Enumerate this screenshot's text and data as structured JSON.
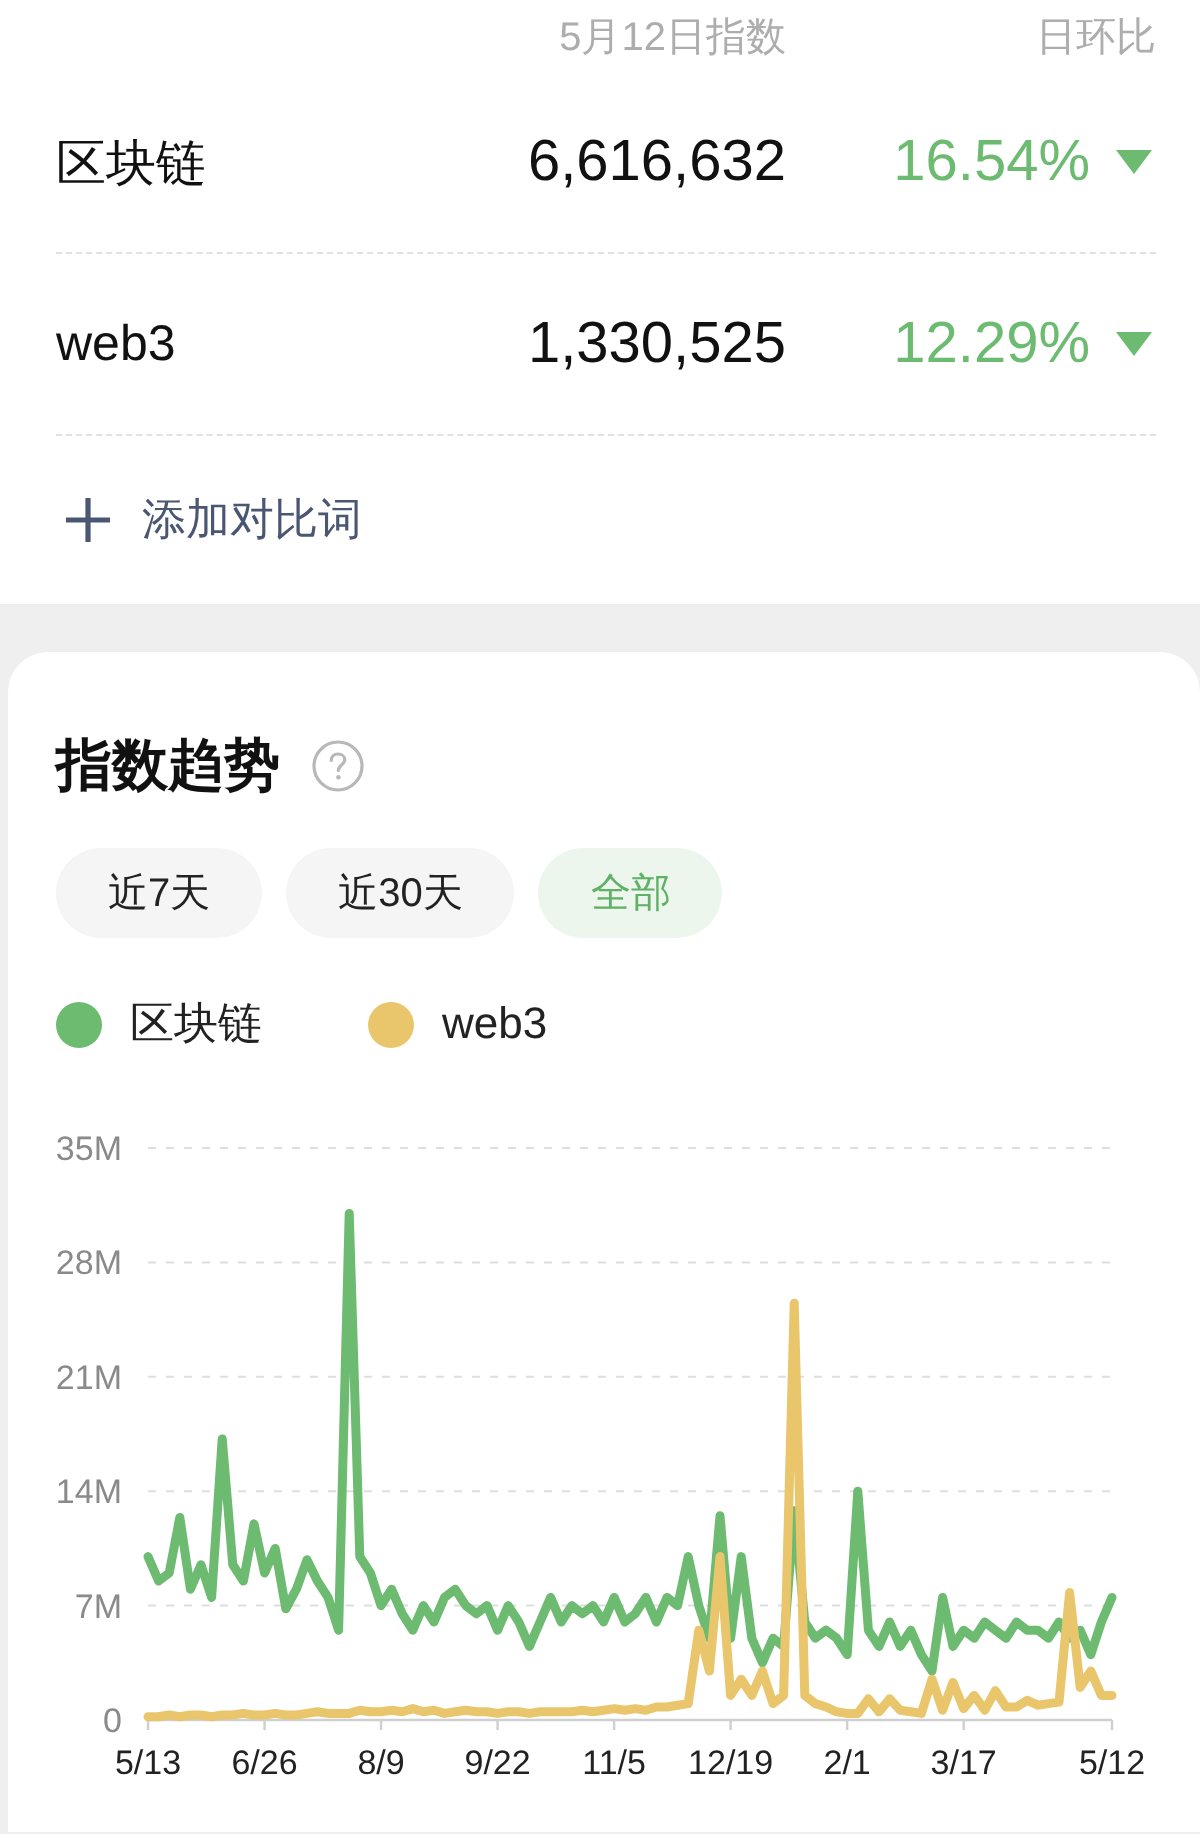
{
  "header": {
    "index_label": "5月12日指数",
    "change_label": "日环比"
  },
  "keywords": [
    {
      "name": "区块链",
      "index": "6,616,632",
      "change": "16.54%",
      "down": true
    },
    {
      "name": "web3",
      "index": "1,330,525",
      "change": "12.29%",
      "down": true
    }
  ],
  "add_button": {
    "label": "添加对比词"
  },
  "trend": {
    "title": "指数趋势",
    "ranges": [
      {
        "label": "近7天",
        "selected": false
      },
      {
        "label": "近30天",
        "selected": false
      },
      {
        "label": "全部",
        "selected": true
      }
    ],
    "chart_data": {
      "type": "line",
      "grid": true,
      "categories": [
        "5/13",
        null,
        null,
        null,
        null,
        null,
        null,
        null,
        null,
        null,
        null,
        "6/26",
        null,
        null,
        null,
        null,
        null,
        null,
        null,
        null,
        null,
        null,
        "8/9",
        null,
        null,
        null,
        null,
        null,
        null,
        null,
        null,
        null,
        null,
        "9/22",
        null,
        null,
        null,
        null,
        null,
        null,
        null,
        null,
        null,
        null,
        "11/5",
        null,
        null,
        null,
        null,
        null,
        null,
        null,
        null,
        null,
        null,
        "12/19",
        null,
        null,
        null,
        null,
        null,
        null,
        null,
        null,
        null,
        null,
        "2/1",
        null,
        null,
        null,
        null,
        null,
        null,
        null,
        null,
        null,
        null,
        "3/17",
        null,
        null,
        null,
        null,
        null,
        null,
        null,
        null,
        null,
        null,
        null,
        null,
        null,
        "5/12"
      ],
      "series": [
        {
          "name": "区块链",
          "color": "#6dba71",
          "values": [
            10,
            8.5,
            9,
            12.4,
            8,
            9.5,
            7.5,
            17.2,
            9.5,
            8.5,
            12,
            9,
            10.5,
            6.8,
            8,
            9.8,
            8.5,
            7.5,
            5.5,
            31,
            10,
            9,
            7,
            8,
            6.5,
            5.5,
            7,
            6,
            7.5,
            8,
            7,
            6.5,
            7,
            5.5,
            7,
            6,
            4.5,
            6,
            7.5,
            6,
            7,
            6.5,
            7,
            6,
            7.5,
            6,
            6.5,
            7.5,
            6,
            7.5,
            7,
            10,
            7,
            5,
            12.5,
            5,
            10,
            5,
            3.5,
            5,
            4.5,
            12.8,
            6,
            5,
            5.5,
            5,
            4,
            14,
            5.5,
            4.5,
            6,
            4.5,
            5.5,
            4,
            3,
            7.5,
            4.5,
            5.5,
            5,
            6,
            5.5,
            5,
            6,
            5.5,
            5.5,
            5,
            6,
            5,
            5.5,
            4,
            6,
            7.5
          ]
        },
        {
          "name": "web3",
          "color": "#e9c66c",
          "values": [
            0.2,
            0.2,
            0.3,
            0.2,
            0.3,
            0.3,
            0.2,
            0.3,
            0.3,
            0.4,
            0.3,
            0.3,
            0.4,
            0.3,
            0.3,
            0.4,
            0.5,
            0.4,
            0.4,
            0.4,
            0.6,
            0.5,
            0.5,
            0.6,
            0.5,
            0.7,
            0.5,
            0.6,
            0.4,
            0.5,
            0.6,
            0.5,
            0.5,
            0.4,
            0.5,
            0.5,
            0.4,
            0.5,
            0.5,
            0.5,
            0.5,
            0.6,
            0.5,
            0.6,
            0.7,
            0.6,
            0.7,
            0.6,
            0.8,
            0.8,
            0.9,
            1,
            5.5,
            3,
            10,
            1.5,
            2.5,
            1.5,
            3,
            1,
            1.5,
            25.5,
            1.5,
            1,
            0.8,
            0.5,
            0.4,
            0.4,
            1.3,
            0.5,
            1.3,
            0.6,
            0.5,
            0.4,
            2.5,
            0.6,
            2.3,
            0.7,
            1.5,
            0.6,
            1.8,
            0.8,
            0.8,
            1.2,
            0.9,
            1,
            1.1,
            7.8,
            2,
            3,
            1.5,
            1.5
          ]
        }
      ],
      "ylim": [
        0,
        35
      ],
      "yticks": [
        {
          "value": 0,
          "label": "0"
        },
        {
          "value": 7,
          "label": "7M"
        },
        {
          "value": 14,
          "label": "14M"
        },
        {
          "value": 21,
          "label": "21M"
        },
        {
          "value": 28,
          "label": "28M"
        },
        {
          "value": 35,
          "label": "35M"
        }
      ]
    }
  }
}
